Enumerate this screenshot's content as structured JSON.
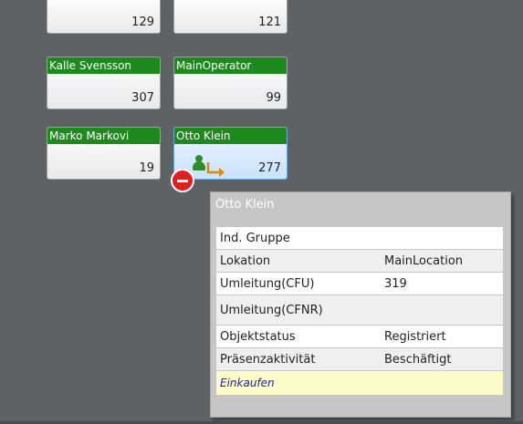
{
  "cards": [
    {
      "name": "",
      "value": "129"
    },
    {
      "name": "",
      "value": "121"
    },
    {
      "name": "Kalle Svensson",
      "value": "307"
    },
    {
      "name": "MainOperator",
      "value": "99"
    },
    {
      "name": "Marko Markovi",
      "value": "19"
    },
    {
      "name": "Otto Klein",
      "value": "277"
    }
  ],
  "tooltip": {
    "title": "Otto Klein",
    "rows": [
      {
        "label": "Ind. Gruppe",
        "value": ""
      },
      {
        "label": "Lokation",
        "value": "MainLocation"
      },
      {
        "label": "Umleitung(CFU)",
        "value": "319"
      },
      {
        "label": "Umleitung(CFNR)",
        "value": ""
      },
      {
        "label": "Objektstatus",
        "value": "Registriert"
      },
      {
        "label": "Präsenzaktivität",
        "value": "Beschäftigt"
      }
    ],
    "note": "Einkaufen"
  },
  "icons": {
    "presence": "person-icon",
    "do_not_disturb": "do-not-disturb-icon",
    "forward": "call-forward-icon"
  },
  "colors": {
    "background": "#5e6265",
    "header_green": "#1e8a1e",
    "dnd_red": "#e02020",
    "note_text": "#1a1ad6",
    "note_background": "#fdfbc8"
  }
}
